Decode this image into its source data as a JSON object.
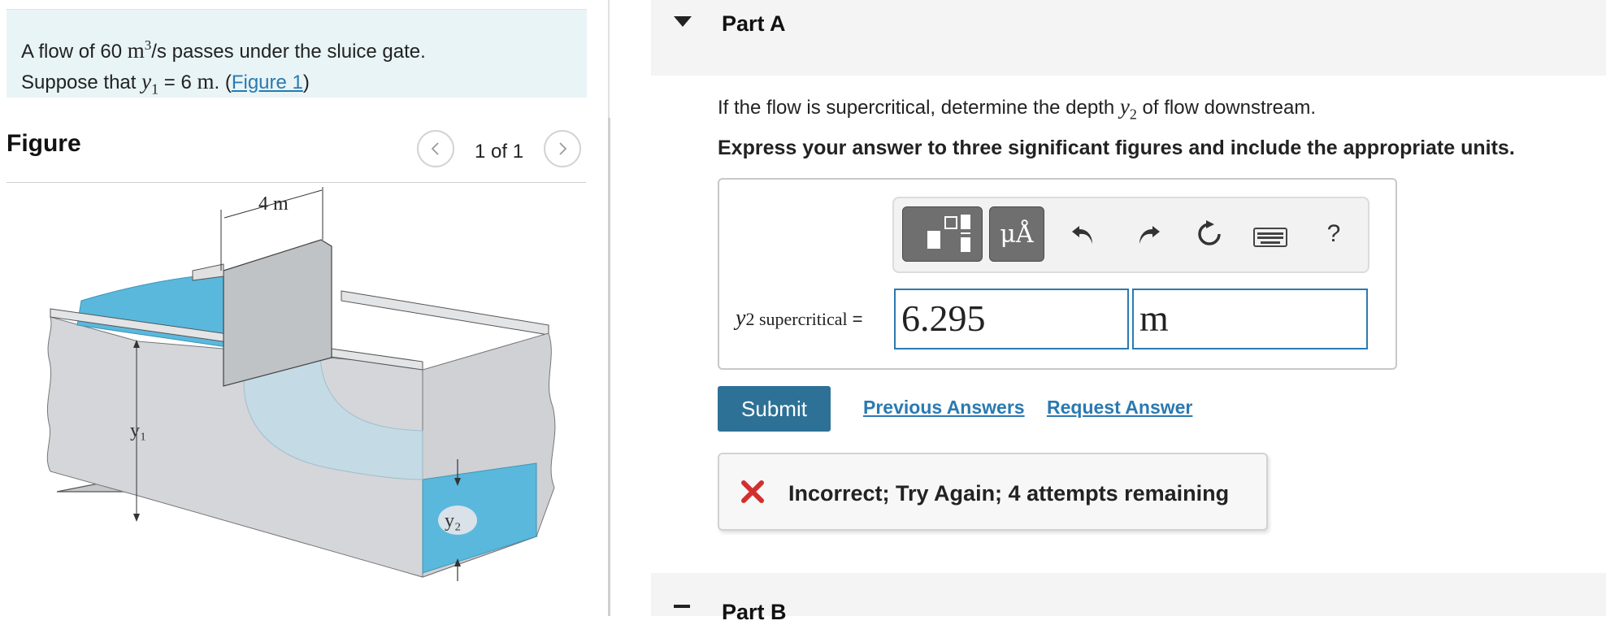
{
  "problem": {
    "text_part1": "A flow of 60 ",
    "unit_m": "m",
    "unit_exp": "3",
    "text_part2": "/s passes under the sluice gate.",
    "text_line2_prefix": "Suppose that ",
    "var_y": "y",
    "var_sub": "1",
    "text_line2_value": " = 6 ",
    "text_line2_unit": "m",
    "text_line2_open": ". (",
    "figure_link": "Figure 1",
    "text_line2_close": ")"
  },
  "figure": {
    "title": "Figure",
    "page_count": "1 of 1",
    "labels": {
      "width": "4 m",
      "y1": "y₁",
      "y2": "y₂"
    },
    "colors": {
      "water": "#5ab8dd",
      "channel": "#d5d7da",
      "gate": "#bfc3c6"
    }
  },
  "partA": {
    "title": "Part A",
    "question_prefix": "If the flow is supercritical, determine the depth ",
    "question_var": "y",
    "question_sub": "2",
    "question_suffix": " of flow downstream.",
    "instruction": "Express your answer to three significant figures and include the appropriate units.",
    "toolbar": {
      "units_label": "μÅ",
      "help_label": "?",
      "icons": [
        "template-icon",
        "units-icon",
        "undo-icon",
        "redo-icon",
        "reset-icon",
        "keyboard-icon",
        "help-icon"
      ]
    },
    "answer": {
      "var": "y",
      "sub": "2",
      "label_suffix": " supercritical",
      "equals": "=",
      "value": "6.295",
      "unit": "m"
    },
    "submit_label": "Submit",
    "previous_answers_label": "Previous Answers",
    "request_answer_label": "Request Answer",
    "feedback": "Incorrect; Try Again; 4 attempts remaining",
    "colors": {
      "accent": "#2e7196",
      "link": "#2a7ab0",
      "error": "#d32f2f"
    }
  },
  "partB": {
    "title": "Part B"
  }
}
